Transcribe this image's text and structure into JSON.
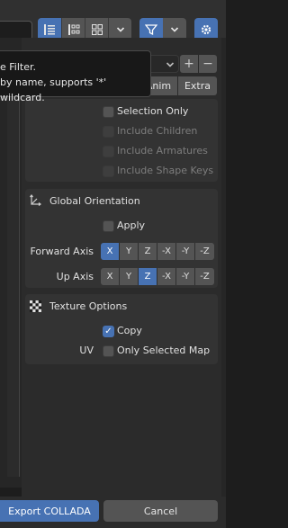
{
  "toolbar": {
    "view_buttons": [
      {
        "icon": "list-view-icon",
        "active": true
      },
      {
        "icon": "thumbnail-small-icon",
        "active": false
      },
      {
        "icon": "thumbnail-large-icon",
        "active": false
      }
    ],
    "view_dropdown_icon": "chevron-down-icon",
    "filter_icon": "funnel-icon",
    "filter_dropdown_icon": "chevron-down-icon",
    "settings_icon": "gear-icon"
  },
  "tooltip": {
    "line1": "e Filter.",
    "line2": "by name, supports '*' wildcard."
  },
  "export_tabs": {
    "partial_visible": "Anim",
    "extra": "Extra"
  },
  "include": {
    "selection_only": "Selection Only",
    "include_children": "Include Children",
    "include_armatures": "Include Armatures",
    "include_shape_keys": "Include Shape Keys"
  },
  "global_orientation": {
    "title": "Global Orientation",
    "apply_label": "Apply",
    "forward_axis_label": "Forward Axis",
    "up_axis_label": "Up Axis",
    "axes": [
      "X",
      "Y",
      "Z",
      "-X",
      "-Y",
      "-Z"
    ],
    "forward_selected": "X",
    "up_selected": "Z"
  },
  "texture_options": {
    "title": "Texture Options",
    "copy_label": "Copy",
    "uv_label": "UV",
    "only_selected_map_label": "Only Selected Map"
  },
  "footer": {
    "export_label": "Export COLLADA",
    "cancel_label": "Cancel"
  },
  "colors": {
    "accent": "#4772b3",
    "panel": "#333333",
    "button": "#545454"
  }
}
